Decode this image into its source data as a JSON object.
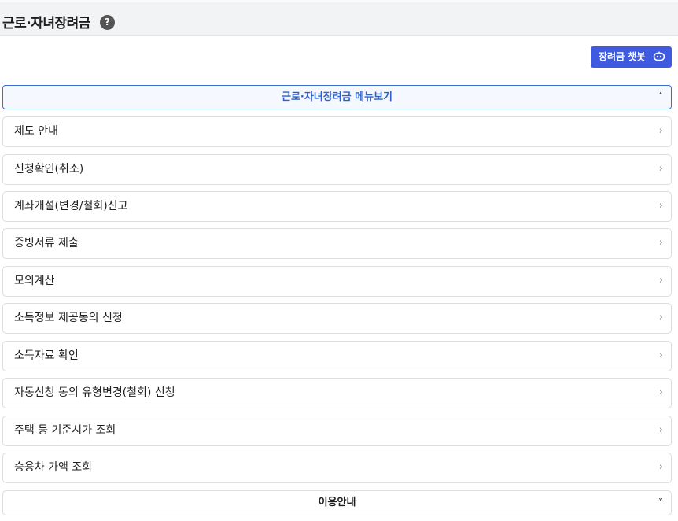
{
  "header": {
    "title": "근로·자녀장려금",
    "help_icon": "?"
  },
  "chatbot": {
    "label": "장려금 챗봇",
    "icon": "robot-icon"
  },
  "menu_toggle": {
    "label": "근로·자녀장려금 메뉴보기",
    "chevron": "˄"
  },
  "menu": {
    "chevron": "›",
    "items": [
      {
        "label": "제도 안내"
      },
      {
        "label": "신청확인(취소)"
      },
      {
        "label": "계좌개설(변경/철회)신고"
      },
      {
        "label": "증빙서류 제출"
      },
      {
        "label": "모의계산"
      },
      {
        "label": "소득정보 제공동의 신청"
      },
      {
        "label": "소득자료 확인"
      },
      {
        "label": "자동신청 동의 유형변경(철회) 신청"
      },
      {
        "label": "주택 등 기준시가 조회"
      },
      {
        "label": "승용차 가액 조회"
      }
    ]
  },
  "info_toggle": {
    "label": "이용안내",
    "chevron": "˅"
  },
  "colors": {
    "accent": "#3d5ae0",
    "toggle_border": "#3d6ad6",
    "toggle_text": "#2f5fc9"
  }
}
